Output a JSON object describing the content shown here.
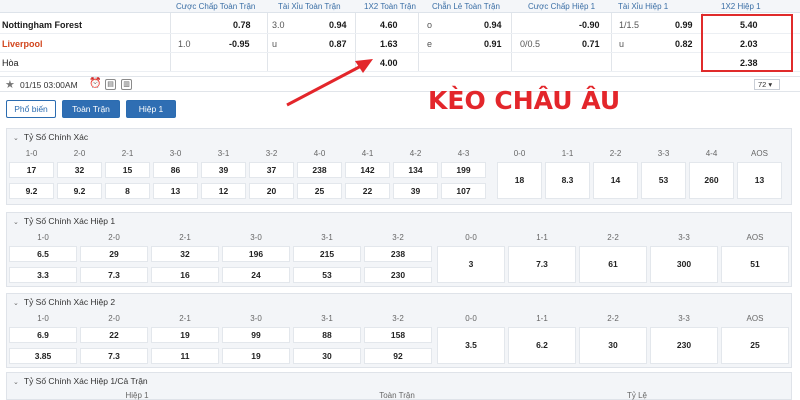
{
  "odds_table": {
    "headers": [
      "Cược Chấp Toàn Trận",
      "Tài Xỉu Toàn Trận",
      "1X2 Toàn Trận",
      "Chẵn Lẻ Toàn Trận",
      "Cược Chấp Hiệp 1",
      "Tài Xỉu Hiệp 1",
      "1X2 Hiệp 1"
    ],
    "rows": [
      {
        "team": "Nottingham Forest",
        "hc_line": "",
        "hc_odds": "0.78",
        "ou_line": "3.0",
        "ou_odds": "0.94",
        "x12": "4.60",
        "oe_label": "o",
        "oe_odds": "0.94",
        "h1hc_line": "",
        "h1hc_odds": "-0.90",
        "h1ou_line": "1/1.5",
        "h1ou_odds": "0.99",
        "h1x12": "5.40"
      },
      {
        "team": "Liverpool",
        "hc_line": "1.0",
        "hc_odds": "-0.95",
        "ou_line": "u",
        "ou_odds": "0.87",
        "x12": "1.63",
        "oe_label": "e",
        "oe_odds": "0.91",
        "h1hc_line": "0/0.5",
        "h1hc_odds": "0.71",
        "h1ou_line": "u",
        "h1ou_odds": "0.82",
        "h1x12": "2.03"
      },
      {
        "team": "Hòa",
        "x12": "4.00",
        "h1x12": "2.38"
      }
    ]
  },
  "date_bar": {
    "date": "01/15 03:00AM",
    "more": "72"
  },
  "tabs": [
    "Phổ biến",
    "Toàn Trận",
    "Hiệp 1"
  ],
  "overlay_label": "KÈO CHÂU ÂU",
  "sections": {
    "s1": {
      "title": "Tỷ Số Chính Xác",
      "headers": [
        "1-0",
        "2-0",
        "2-1",
        "3-0",
        "3-1",
        "3-2",
        "4-0",
        "4-1",
        "4-2",
        "4-3",
        "0-0",
        "1-1",
        "2-2",
        "3-3",
        "4-4",
        "AOS"
      ],
      "row1": [
        "17",
        "32",
        "15",
        "86",
        "39",
        "37",
        "238",
        "142",
        "134",
        "199"
      ],
      "row2": [
        "9.2",
        "9.2",
        "8",
        "13",
        "12",
        "20",
        "25",
        "22",
        "39",
        "107"
      ],
      "draws": [
        "18",
        "8.3",
        "14",
        "53",
        "260",
        "13"
      ]
    },
    "s2": {
      "title": "Tỷ Số Chính Xác Hiệp 1",
      "headers": [
        "1-0",
        "2-0",
        "2-1",
        "3-0",
        "3-1",
        "3-2",
        "0-0",
        "1-1",
        "2-2",
        "3-3",
        "AOS"
      ],
      "row1": [
        "6.5",
        "29",
        "32",
        "196",
        "215",
        "238"
      ],
      "row2": [
        "3.3",
        "7.3",
        "16",
        "24",
        "53",
        "230"
      ],
      "draws": [
        "3",
        "7.3",
        "61",
        "300",
        "51"
      ]
    },
    "s3": {
      "title": "Tỷ Số Chính Xác Hiệp 2",
      "headers": [
        "1-0",
        "2-0",
        "2-1",
        "3-0",
        "3-1",
        "3-2",
        "0-0",
        "1-1",
        "2-2",
        "3-3",
        "AOS"
      ],
      "row1": [
        "6.9",
        "22",
        "19",
        "99",
        "88",
        "158"
      ],
      "row2": [
        "3.85",
        "7.3",
        "11",
        "19",
        "30",
        "92"
      ],
      "draws": [
        "3.5",
        "6.2",
        "30",
        "230",
        "25"
      ]
    },
    "s4": {
      "title": "Tỷ Số Chính Xác Hiệp 1/Cả Trận",
      "headers": [
        "Hiệp 1",
        "Toàn Trận",
        "Tỷ Lệ"
      ]
    }
  },
  "colors": {
    "accent": "#2f6eb3",
    "highlight": "#e02b2b",
    "negative": "#e0662b"
  }
}
